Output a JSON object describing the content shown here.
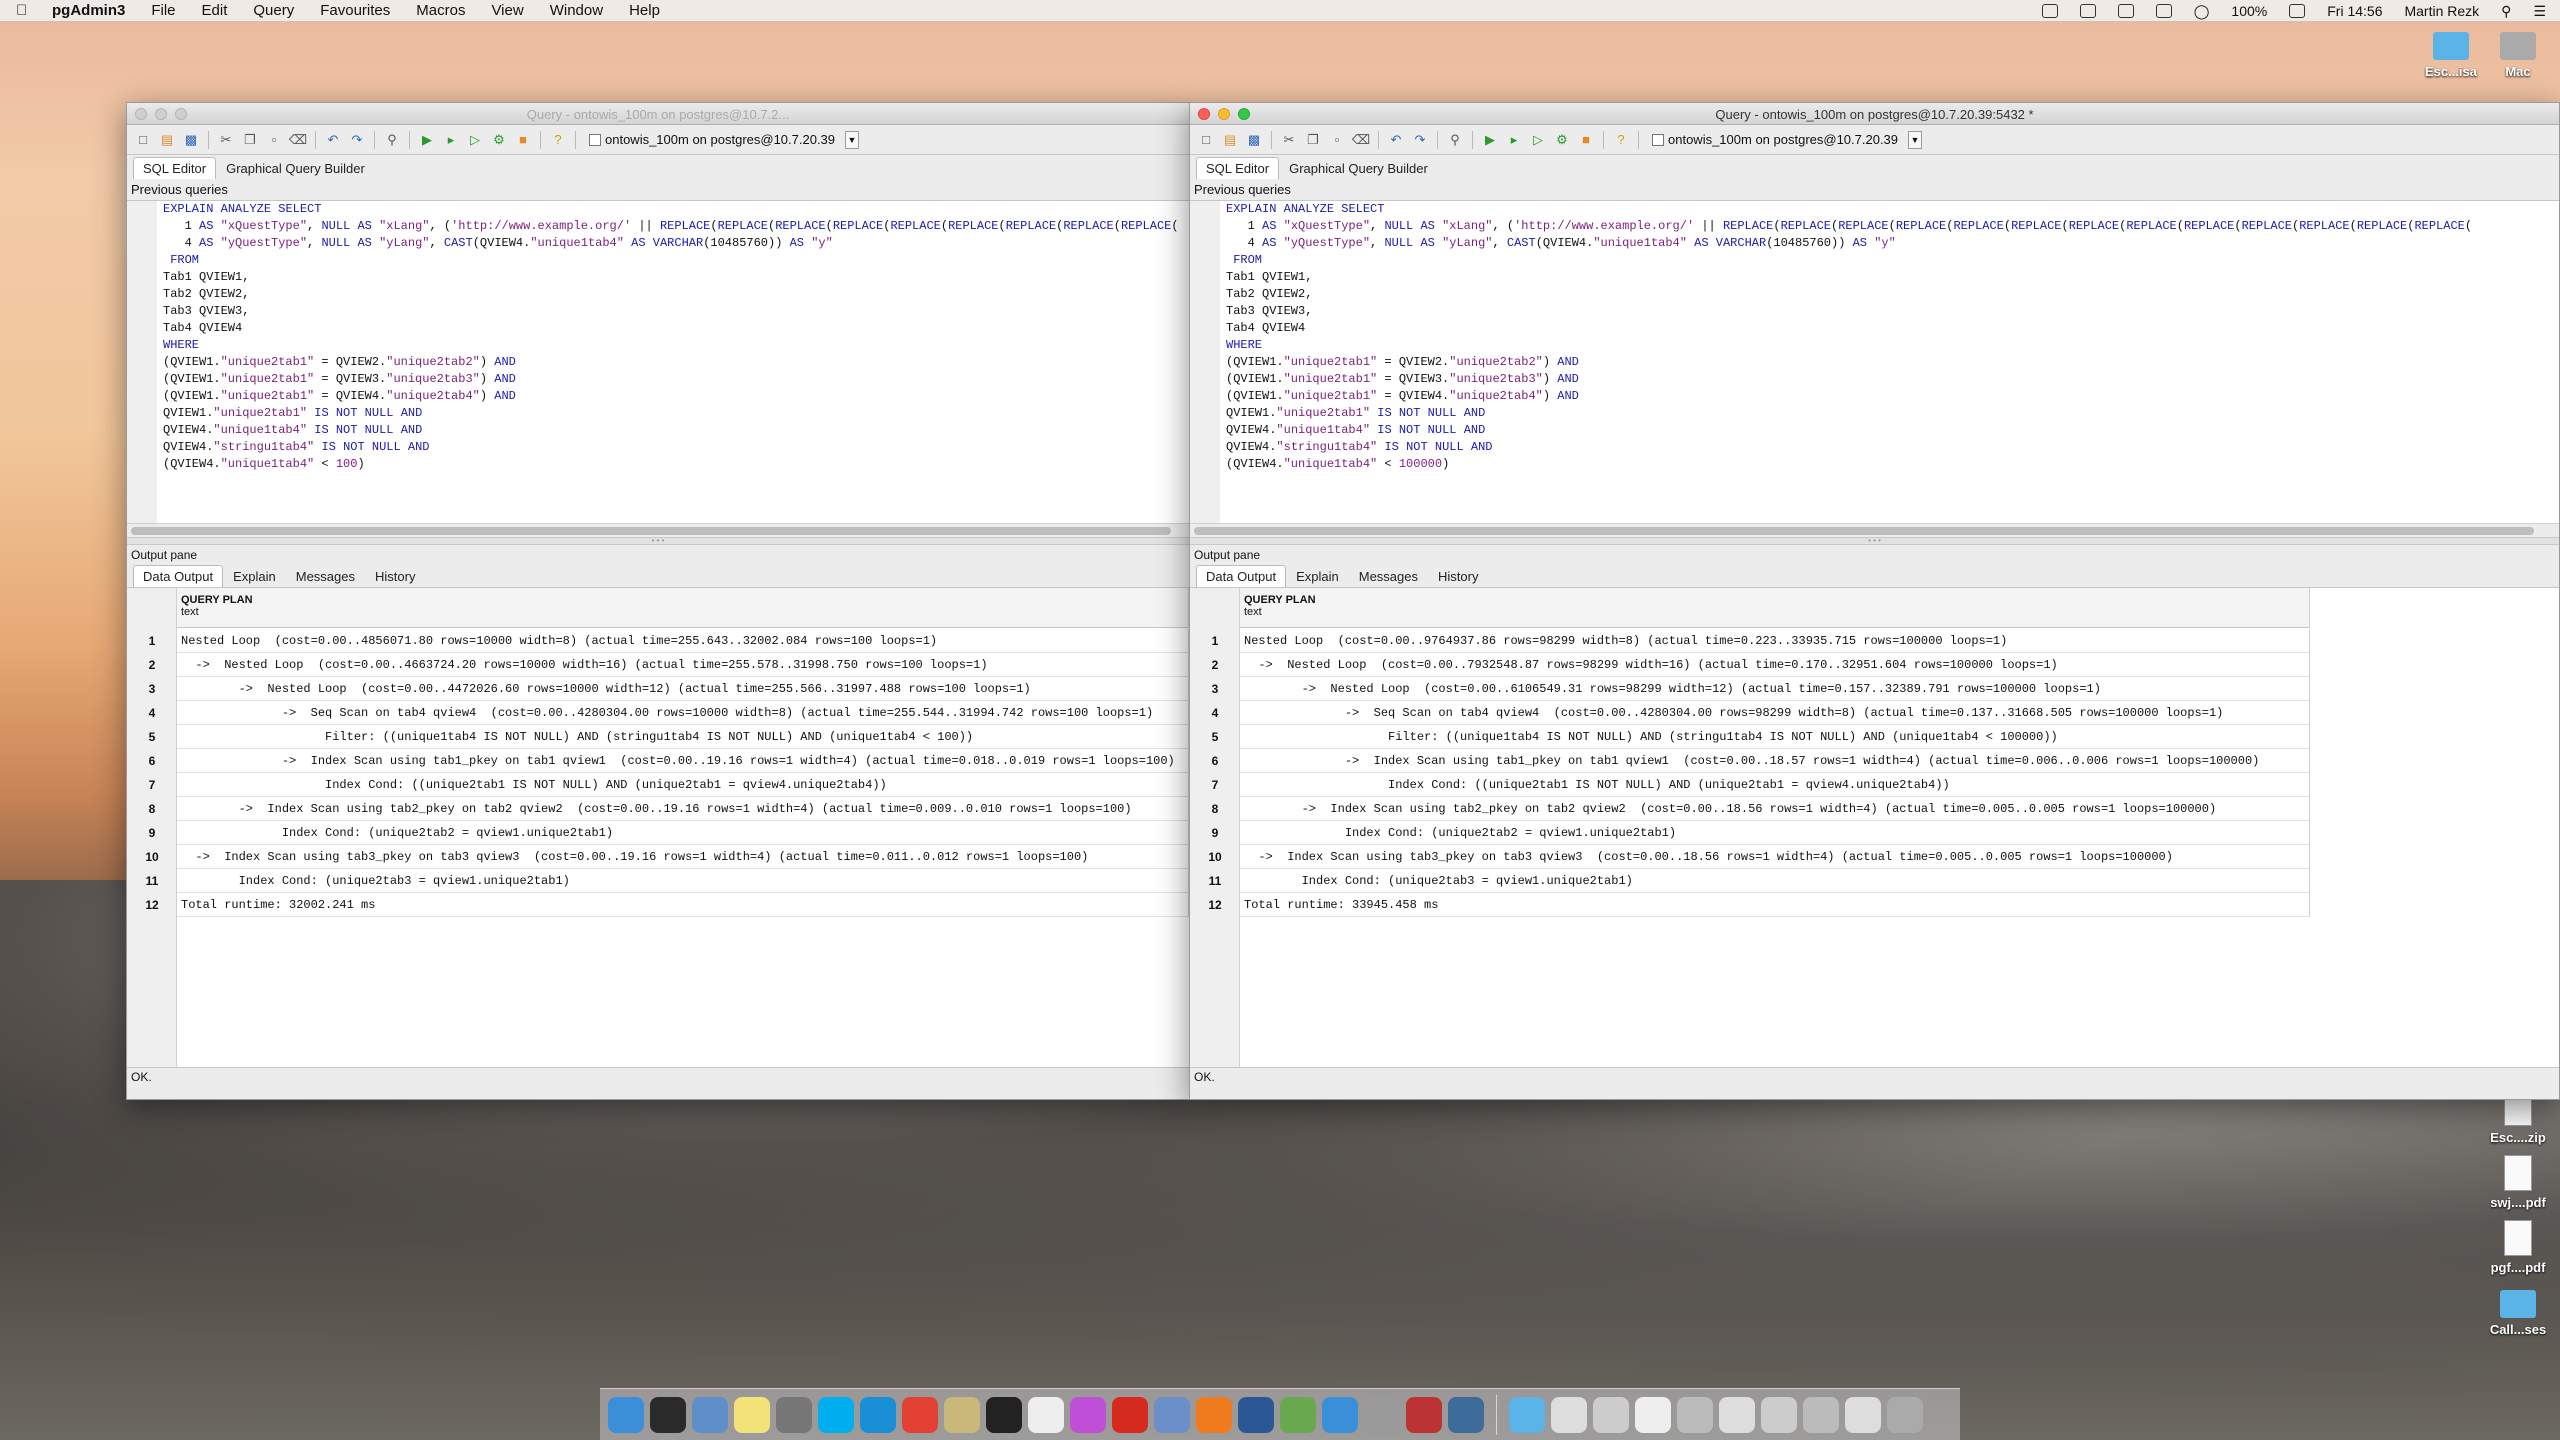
{
  "menubar": {
    "app": "pgAdmin3",
    "items": [
      "File",
      "Edit",
      "Query",
      "Favourites",
      "Macros",
      "View",
      "Window",
      "Help"
    ],
    "battery": "100%",
    "clock": "Fri 14:56",
    "user": "Martin Rezk"
  },
  "desktop": {
    "icons": [
      {
        "label": "Esc...isa",
        "kind": "folder"
      },
      {
        "label": "Mac",
        "kind": "folder"
      },
      {
        "label": "Esc....zip",
        "kind": "doc"
      },
      {
        "label": "swj....pdf",
        "kind": "doc"
      },
      {
        "label": "pgf....pdf",
        "kind": "doc"
      },
      {
        "label": "Call...ses",
        "kind": "folder"
      }
    ]
  },
  "left_window": {
    "title": "Query - ontowis_100m on postgres@10.7.2...",
    "connection": "ontowis_100m on postgres@10.7.20.39",
    "tabs": [
      "SQL Editor",
      "Graphical Query Builder"
    ],
    "previous_queries": "Previous queries",
    "sql": [
      "EXPLAIN ANALYZE SELECT",
      "   1 AS \"xQuestType\", NULL AS \"xLang\", ('http://www.example.org/' || REPLACE(REPLACE(REPLACE(REPLACE(REPLACE(REPLACE(REPLACE(REPLACE(REPLACE(",
      "   4 AS \"yQuestType\", NULL AS \"yLang\", CAST(QVIEW4.\"unique1tab4\" AS VARCHAR(10485760)) AS \"y\"",
      " FROM",
      "Tab1 QVIEW1,",
      "Tab2 QVIEW2,",
      "Tab3 QVIEW3,",
      "Tab4 QVIEW4",
      "WHERE",
      "(QVIEW1.\"unique2tab1\" = QVIEW2.\"unique2tab2\") AND",
      "(QVIEW1.\"unique2tab1\" = QVIEW3.\"unique2tab3\") AND",
      "(QVIEW1.\"unique2tab1\" = QVIEW4.\"unique2tab4\") AND",
      "QVIEW1.\"unique2tab1\" IS NOT NULL AND",
      "QVIEW4.\"unique1tab4\" IS NOT NULL AND",
      "QVIEW4.\"stringu1tab4\" IS NOT NULL AND",
      "(QVIEW4.\"unique1tab4\" < 100)"
    ],
    "output_pane": "Output pane",
    "output_tabs": [
      "Data Output",
      "Explain",
      "Messages",
      "History"
    ],
    "column_header": "QUERY PLAN",
    "column_type": "text",
    "rows": [
      "Nested Loop  (cost=0.00..4856071.80 rows=10000 width=8) (actual time=255.643..32002.084 rows=100 loops=1)",
      "  ->  Nested Loop  (cost=0.00..4663724.20 rows=10000 width=16) (actual time=255.578..31998.750 rows=100 loops=1)",
      "        ->  Nested Loop  (cost=0.00..4472026.60 rows=10000 width=12) (actual time=255.566..31997.488 rows=100 loops=1)",
      "              ->  Seq Scan on tab4 qview4  (cost=0.00..4280304.00 rows=10000 width=8) (actual time=255.544..31994.742 rows=100 loops=1)",
      "                    Filter: ((unique1tab4 IS NOT NULL) AND (stringu1tab4 IS NOT NULL) AND (unique1tab4 < 100))",
      "              ->  Index Scan using tab1_pkey on tab1 qview1  (cost=0.00..19.16 rows=1 width=4) (actual time=0.018..0.019 rows=1 loops=100)",
      "                    Index Cond: ((unique2tab1 IS NOT NULL) AND (unique2tab1 = qview4.unique2tab4))",
      "        ->  Index Scan using tab2_pkey on tab2 qview2  (cost=0.00..19.16 rows=1 width=4) (actual time=0.009..0.010 rows=1 loops=100)",
      "              Index Cond: (unique2tab2 = qview1.unique2tab1)",
      "  ->  Index Scan using tab3_pkey on tab3 qview3  (cost=0.00..19.16 rows=1 width=4) (actual time=0.011..0.012 rows=1 loops=100)",
      "        Index Cond: (unique2tab3 = qview1.unique2tab1)",
      "Total runtime: 32002.241 ms"
    ],
    "status": "OK."
  },
  "right_window": {
    "title": "Query - ontowis_100m on postgres@10.7.20.39:5432 *",
    "connection": "ontowis_100m on postgres@10.7.20.39",
    "tabs": [
      "SQL Editor",
      "Graphical Query Builder"
    ],
    "previous_queries": "Previous queries",
    "sql": [
      "EXPLAIN ANALYZE SELECT",
      "   1 AS \"xQuestType\", NULL AS \"xLang\", ('http://www.example.org/' || REPLACE(REPLACE(REPLACE(REPLACE(REPLACE(REPLACE(REPLACE(REPLACE(REPLACE(REPLACE(REPLACE(REPLACE(REPLACE(",
      "   4 AS \"yQuestType\", NULL AS \"yLang\", CAST(QVIEW4.\"unique1tab4\" AS VARCHAR(10485760)) AS \"y\"",
      " FROM",
      "Tab1 QVIEW1,",
      "Tab2 QVIEW2,",
      "Tab3 QVIEW3,",
      "Tab4 QVIEW4",
      "WHERE",
      "(QVIEW1.\"unique2tab1\" = QVIEW2.\"unique2tab2\") AND",
      "(QVIEW1.\"unique2tab1\" = QVIEW3.\"unique2tab3\") AND",
      "(QVIEW1.\"unique2tab1\" = QVIEW4.\"unique2tab4\") AND",
      "QVIEW1.\"unique2tab1\" IS NOT NULL AND",
      "QVIEW4.\"unique1tab4\" IS NOT NULL AND",
      "QVIEW4.\"stringu1tab4\" IS NOT NULL AND",
      "(QVIEW4.\"unique1tab4\" < 100000)"
    ],
    "output_pane": "Output pane",
    "output_tabs": [
      "Data Output",
      "Explain",
      "Messages",
      "History"
    ],
    "column_header": "QUERY PLAN",
    "column_type": "text",
    "rows": [
      "Nested Loop  (cost=0.00..9764937.86 rows=98299 width=8) (actual time=0.223..33935.715 rows=100000 loops=1)",
      "  ->  Nested Loop  (cost=0.00..7932548.87 rows=98299 width=16) (actual time=0.170..32951.604 rows=100000 loops=1)",
      "        ->  Nested Loop  (cost=0.00..6106549.31 rows=98299 width=12) (actual time=0.157..32389.791 rows=100000 loops=1)",
      "              ->  Seq Scan on tab4 qview4  (cost=0.00..4280304.00 rows=98299 width=8) (actual time=0.137..31668.505 rows=100000 loops=1)",
      "                    Filter: ((unique1tab4 IS NOT NULL) AND (stringu1tab4 IS NOT NULL) AND (unique1tab4 < 100000))",
      "              ->  Index Scan using tab1_pkey on tab1 qview1  (cost=0.00..18.57 rows=1 width=4) (actual time=0.006..0.006 rows=1 loops=100000)",
      "                    Index Cond: ((unique2tab1 IS NOT NULL) AND (unique2tab1 = qview4.unique2tab4))",
      "        ->  Index Scan using tab2_pkey on tab2 qview2  (cost=0.00..18.56 rows=1 width=4) (actual time=0.005..0.005 rows=1 loops=100000)",
      "              Index Cond: (unique2tab2 = qview1.unique2tab1)",
      "  ->  Index Scan using tab3_pkey on tab3 qview3  (cost=0.00..18.56 rows=1 width=4) (actual time=0.005..0.005 rows=1 loops=100000)",
      "        Index Cond: (unique2tab3 = qview1.unique2tab1)",
      "Total runtime: 33945.458 ms"
    ],
    "status": "OK."
  },
  "dock": {
    "apps": [
      "finder-icon",
      "monitor-icon",
      "preview-icon",
      "notes-icon",
      "preferences-icon",
      "skype-icon",
      "lync-icon",
      "chrome-icon",
      "pgadmin-icon",
      "terminal-icon",
      "textedit-icon",
      "flower-icon",
      "acrobat-icon",
      "mail-icon",
      "firefox-icon",
      "word-icon",
      "network-icon",
      "safari-icon",
      "tool-icon",
      "dictionary-icon",
      "elephant-icon",
      "folder-icon",
      "stack1-icon",
      "stack2-icon",
      "stack3-icon",
      "stack4-icon",
      "stack5-icon",
      "stack6-icon",
      "stack7-icon",
      "stack8-icon",
      "trash-icon"
    ]
  }
}
